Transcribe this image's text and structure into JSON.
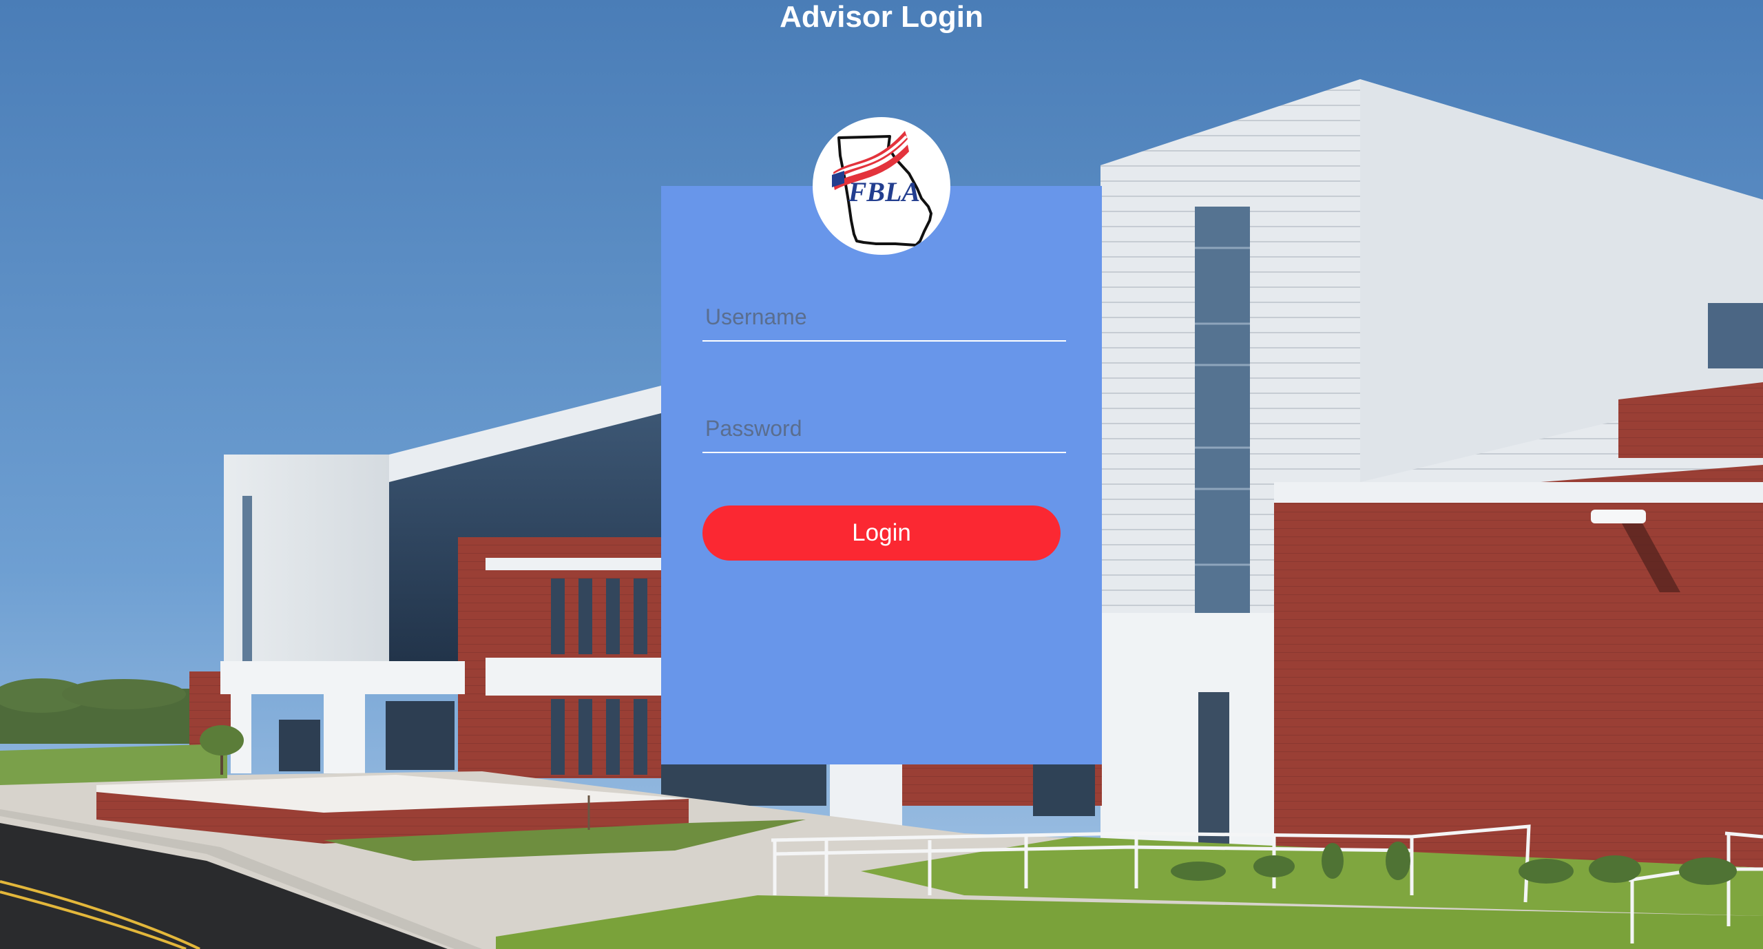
{
  "page": {
    "title": "Advisor Login"
  },
  "logo": {
    "text": "FBLA",
    "icon": "fbla-georgia-logo-icon"
  },
  "form": {
    "username_placeholder": "Username",
    "username_value": "",
    "password_placeholder": "Password",
    "password_value": "",
    "login_label": "Login"
  },
  "colors": {
    "card_bg": "#6896ea",
    "button_bg": "#fb2832",
    "text": "#ffffff"
  }
}
